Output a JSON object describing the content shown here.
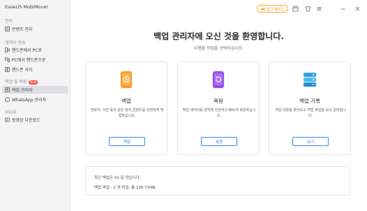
{
  "app": {
    "title": "EaseUS MobiMover"
  },
  "sidebar": {
    "sections": [
      {
        "label": "관리",
        "items": [
          {
            "label": "콘텐츠 관리",
            "icon": "content-icon"
          }
        ]
      },
      {
        "label": "데이터 전송",
        "items": [
          {
            "label": "핸드폰에서 PC로",
            "icon": "phone-to-pc-icon"
          },
          {
            "label": "PC에서 핸드폰으로",
            "icon": "pc-to-phone-icon"
          },
          {
            "label": "핸드폰 사이",
            "icon": "phone-to-phone-icon"
          }
        ]
      },
      {
        "label": "백업 및 복원",
        "badge": "New",
        "items": [
          {
            "label": "백업 관리자",
            "icon": "backup-manager-icon",
            "active": true
          },
          {
            "label": "WhatsApp 관리자",
            "icon": "whatsapp-icon"
          }
        ]
      },
      {
        "label": "미디어",
        "items": [
          {
            "label": "동영상 다운로드",
            "icon": "video-download-icon"
          }
        ]
      }
    ]
  },
  "topbar": {
    "upgrade_label": "업그레이드",
    "icons": [
      "store-icon",
      "shirt-icon",
      "menu-icon",
      "minimize-icon",
      "close-icon"
    ]
  },
  "main": {
    "title": "백업 관리자에 오신 것을 환영합니다.",
    "subtitle": "수행할 작업을 선택하십시오.",
    "cards": [
      {
        "title": "백업",
        "desc": "연락처, 사진 등과 같은 장치 콘텐츠를 유연하게 백업하십시오.",
        "button": "백업",
        "icon": "backup-phone-icon"
      },
      {
        "title": "복원",
        "desc": "백업 데이터를 장치에 안전하고 빠르게 복원하십시오.",
        "button": "복원",
        "icon": "restore-phone-icon"
      },
      {
        "title": "백업 기록",
        "desc": "백업 내용을 찾아보고 백업 파일을 보고 관리합니다.",
        "button": "보기",
        "icon": "backup-history-icon"
      }
    ],
    "info": {
      "last_backup": "최근 백업은 41 일 전입니다.",
      "backup_files": "백업 파일 : 2 개 파일, 총 136.71MB."
    }
  },
  "colors": {
    "accent": "#2d7be5",
    "upgrade": "#f5a623",
    "backup_icon": "#f7941d",
    "restore_icon": "#8e44e0",
    "history_icon": "#2aa3e0"
  }
}
